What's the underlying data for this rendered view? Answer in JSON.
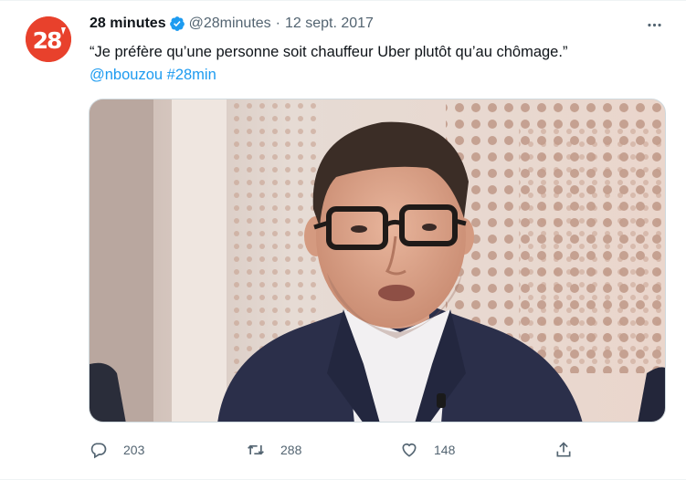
{
  "tweet": {
    "display_name": "28 minutes",
    "handle": "@28minutes",
    "separator": "·",
    "date": "12 sept. 2017",
    "text": "“Je préfère qu’une personne soit chauffeur Uber plutôt qu’au chômage.”",
    "mention": "@nbouzou",
    "hashtag": "#28min",
    "avatar_label": "28",
    "more_icon": "more-icon",
    "verified_icon": "verified-icon",
    "accent_color": "#1d9bf0",
    "avatar_color": "#e8412c"
  },
  "actions": {
    "reply_count": "203",
    "retweet_count": "288",
    "like_count": "148"
  }
}
